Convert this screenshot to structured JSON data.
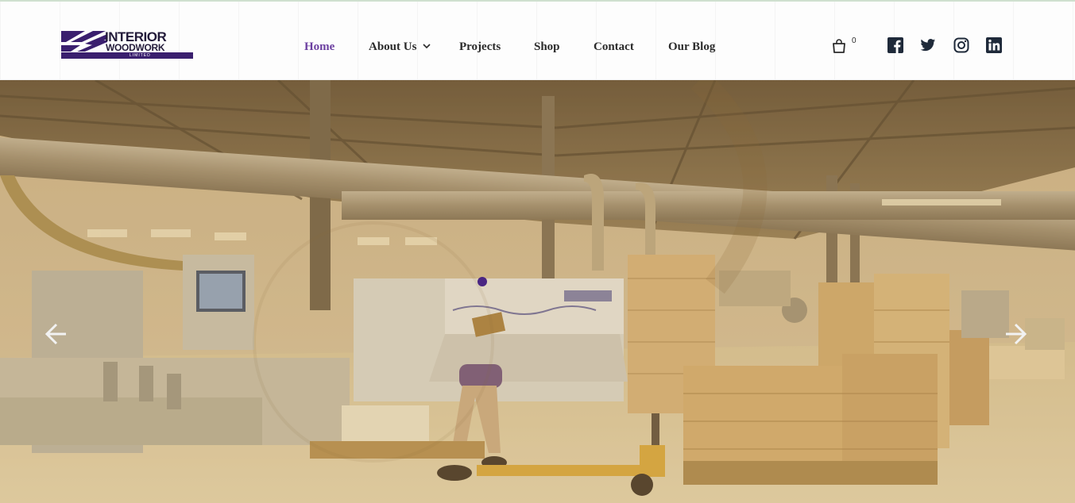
{
  "brand": {
    "name_line1": "INTERIOR",
    "name_line2": "WOODWORK",
    "name_line3": "LIMITED",
    "accent_color": "#6b3fa0",
    "logo_color": "#3a1f6e"
  },
  "nav": {
    "items": [
      {
        "label": "Home",
        "active": true
      },
      {
        "label": "About Us",
        "has_dropdown": true
      },
      {
        "label": "Projects"
      },
      {
        "label": "Shop"
      },
      {
        "label": "Contact"
      },
      {
        "label": "Our Blog"
      }
    ]
  },
  "cart": {
    "icon": "shopping-bag-icon",
    "count": "0"
  },
  "social": [
    {
      "icon": "facebook-icon"
    },
    {
      "icon": "twitter-icon"
    },
    {
      "icon": "instagram-icon"
    },
    {
      "icon": "linkedin-icon"
    }
  ],
  "hero": {
    "prev_icon": "arrow-left-icon",
    "next_icon": "arrow-right-icon",
    "slide_indicator": "slide-dot",
    "overlay_color": "#c9a45a"
  }
}
